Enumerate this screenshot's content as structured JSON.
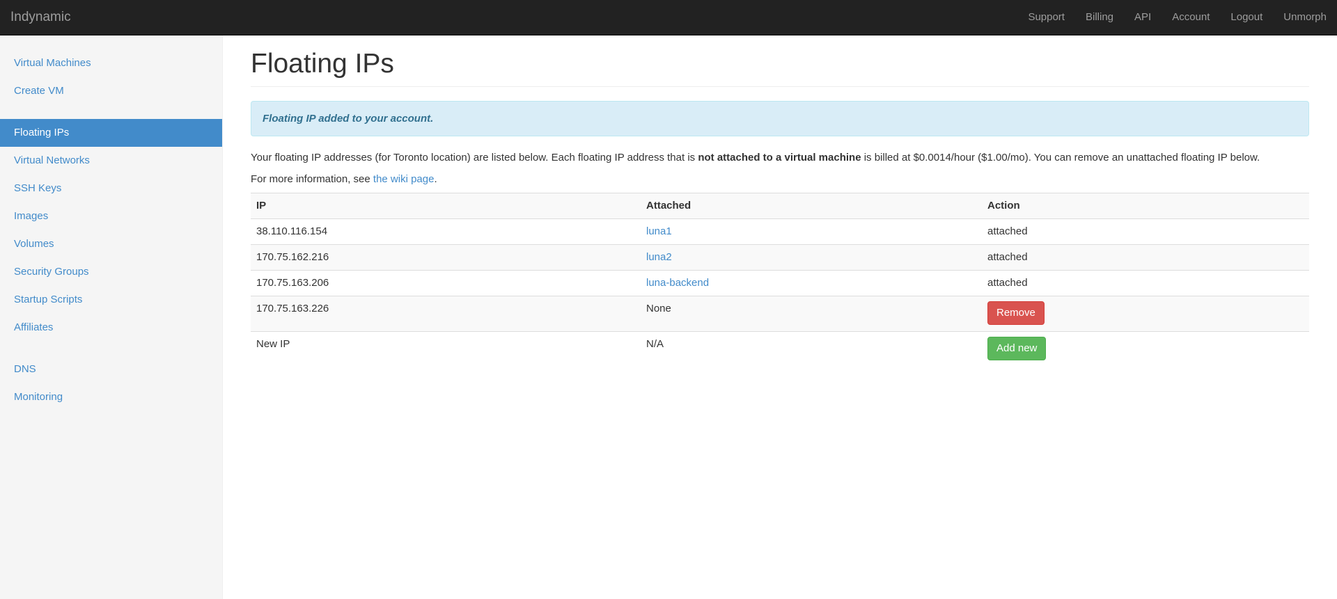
{
  "navbar": {
    "brand": "Indynamic",
    "links": [
      "Support",
      "Billing",
      "API",
      "Account",
      "Logout",
      "Unmorph"
    ]
  },
  "sidebar": {
    "groups": [
      [
        "Virtual Machines",
        "Create VM"
      ],
      [
        "Floating IPs",
        "Virtual Networks",
        "SSH Keys",
        "Images",
        "Volumes",
        "Security Groups",
        "Startup Scripts",
        "Affiliates"
      ],
      [
        "DNS",
        "Monitoring"
      ]
    ],
    "active": "Floating IPs"
  },
  "page": {
    "title": "Floating IPs",
    "alert": "Floating IP added to your account.",
    "desc_part1": "Your floating IP addresses (for Toronto location) are listed below. Each floating IP address that is ",
    "desc_bold": "not attached to a virtual machine",
    "desc_part2": " is billed at $0.0014/hour ($1.00/mo). You can remove an unattached floating IP below.",
    "more_info_prefix": "For more information, see ",
    "more_info_link": "the wiki page",
    "more_info_suffix": "."
  },
  "table": {
    "headers": [
      "IP",
      "Attached",
      "Action"
    ],
    "rows": [
      {
        "ip": "38.110.116.154",
        "attached": "luna1",
        "attached_link": true,
        "action": "attached"
      },
      {
        "ip": "170.75.162.216",
        "attached": "luna2",
        "attached_link": true,
        "action": "attached"
      },
      {
        "ip": "170.75.163.206",
        "attached": "luna-backend",
        "attached_link": true,
        "action": "attached"
      },
      {
        "ip": "170.75.163.226",
        "attached": "None",
        "attached_link": false,
        "action_button": "Remove"
      }
    ],
    "new_row": {
      "ip": "New IP",
      "attached": "N/A",
      "action_button": "Add new"
    }
  }
}
